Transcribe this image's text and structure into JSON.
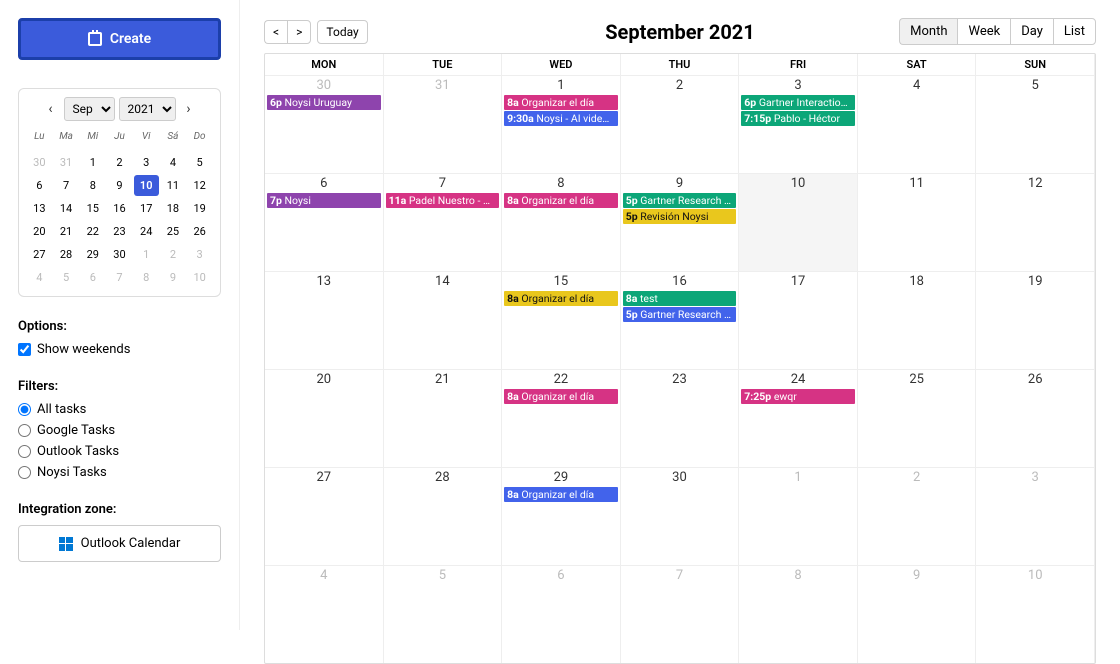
{
  "sidebar": {
    "create_label": "Create",
    "month_select": "Sep",
    "year_select": "2021",
    "mini_heads": [
      "Lu",
      "Ma",
      "Mi",
      "Ju",
      "Vi",
      "Sá",
      "Do"
    ],
    "mini_days": [
      {
        "n": "30",
        "m": true
      },
      {
        "n": "31",
        "m": true
      },
      {
        "n": "1"
      },
      {
        "n": "2"
      },
      {
        "n": "3"
      },
      {
        "n": "4"
      },
      {
        "n": "5"
      },
      {
        "n": "6"
      },
      {
        "n": "7"
      },
      {
        "n": "8"
      },
      {
        "n": "9"
      },
      {
        "n": "10",
        "today": true
      },
      {
        "n": "11"
      },
      {
        "n": "12"
      },
      {
        "n": "13"
      },
      {
        "n": "14"
      },
      {
        "n": "15"
      },
      {
        "n": "16"
      },
      {
        "n": "17"
      },
      {
        "n": "18"
      },
      {
        "n": "19"
      },
      {
        "n": "20"
      },
      {
        "n": "21"
      },
      {
        "n": "22"
      },
      {
        "n": "23"
      },
      {
        "n": "24"
      },
      {
        "n": "25"
      },
      {
        "n": "26"
      },
      {
        "n": "27"
      },
      {
        "n": "28"
      },
      {
        "n": "29"
      },
      {
        "n": "30"
      },
      {
        "n": "1",
        "m": true
      },
      {
        "n": "2",
        "m": true
      },
      {
        "n": "3",
        "m": true
      },
      {
        "n": "4",
        "m": true
      },
      {
        "n": "5",
        "m": true
      },
      {
        "n": "6",
        "m": true
      },
      {
        "n": "7",
        "m": true
      },
      {
        "n": "8",
        "m": true
      },
      {
        "n": "9",
        "m": true
      },
      {
        "n": "10",
        "m": true
      }
    ],
    "options_title": "Options:",
    "show_weekends_label": "Show weekends",
    "filters_title": "Filters:",
    "filters": [
      {
        "label": "All tasks",
        "checked": true
      },
      {
        "label": "Google Tasks",
        "checked": false
      },
      {
        "label": "Outlook Tasks",
        "checked": false
      },
      {
        "label": "Noysi Tasks",
        "checked": false
      }
    ],
    "integration_title": "Integration zone:",
    "outlook_label": "Outlook Calendar"
  },
  "toolbar": {
    "prev": "<",
    "next": ">",
    "today": "Today",
    "title": "September 2021",
    "views": [
      "Month",
      "Week",
      "Day",
      "List"
    ],
    "active_view": "Month"
  },
  "calendar": {
    "heads": [
      "MON",
      "TUE",
      "WED",
      "THU",
      "FRI",
      "SAT",
      "SUN"
    ],
    "cells": [
      {
        "n": "30",
        "muted": true,
        "events": [
          {
            "t": "6p",
            "txt": "Noysi Uruguay",
            "c": "purple"
          }
        ]
      },
      {
        "n": "31",
        "muted": true,
        "events": []
      },
      {
        "n": "1",
        "events": [
          {
            "t": "8a",
            "txt": "Organizar el día",
            "c": "pink"
          },
          {
            "t": "9:30a",
            "txt": "Noysi - AI video analy",
            "c": "blue"
          }
        ]
      },
      {
        "n": "2",
        "events": []
      },
      {
        "n": "3",
        "events": [
          {
            "t": "6p",
            "txt": "Gartner Interaction – (Re",
            "c": "teal"
          },
          {
            "t": "7:15p",
            "txt": "Pablo - Héctor",
            "c": "teal"
          }
        ]
      },
      {
        "n": "4",
        "events": []
      },
      {
        "n": "5",
        "events": []
      },
      {
        "n": "6",
        "events": [
          {
            "t": "7p",
            "txt": "Noysi",
            "c": "purple"
          }
        ]
      },
      {
        "n": "7",
        "events": [
          {
            "t": "11a",
            "txt": "Padel Nuestro - Noysi",
            "c": "pink"
          }
        ]
      },
      {
        "n": "8",
        "events": [
          {
            "t": "8a",
            "txt": "Organizar el día",
            "c": "pink"
          }
        ]
      },
      {
        "n": "9",
        "events": [
          {
            "t": "5p",
            "txt": "Gartner Research Conne",
            "c": "teal"
          },
          {
            "t": "5p",
            "txt": "Revisión Noysi",
            "c": "yellow"
          }
        ]
      },
      {
        "n": "10",
        "today": true,
        "events": []
      },
      {
        "n": "11",
        "events": []
      },
      {
        "n": "12",
        "events": []
      },
      {
        "n": "13",
        "events": []
      },
      {
        "n": "14",
        "events": []
      },
      {
        "n": "15",
        "events": [
          {
            "t": "8a",
            "txt": "Organizar el día",
            "c": "yellow"
          }
        ]
      },
      {
        "n": "16",
        "events": [
          {
            "t": "8a",
            "txt": "test",
            "c": "teal"
          },
          {
            "t": "5p",
            "txt": "Gartner Research Conne",
            "c": "blue"
          }
        ]
      },
      {
        "n": "17",
        "events": []
      },
      {
        "n": "18",
        "events": []
      },
      {
        "n": "19",
        "events": []
      },
      {
        "n": "20",
        "events": []
      },
      {
        "n": "21",
        "events": []
      },
      {
        "n": "22",
        "events": [
          {
            "t": "8a",
            "txt": "Organizar el día",
            "c": "pink"
          }
        ]
      },
      {
        "n": "23",
        "events": []
      },
      {
        "n": "24",
        "events": [
          {
            "t": "7:25p",
            "txt": "ewqr",
            "c": "pink"
          }
        ]
      },
      {
        "n": "25",
        "events": []
      },
      {
        "n": "26",
        "events": []
      },
      {
        "n": "27",
        "events": []
      },
      {
        "n": "28",
        "events": []
      },
      {
        "n": "29",
        "events": [
          {
            "t": "8a",
            "txt": "Organizar el día",
            "c": "blue"
          }
        ]
      },
      {
        "n": "30",
        "events": []
      },
      {
        "n": "1",
        "muted": true,
        "events": []
      },
      {
        "n": "2",
        "muted": true,
        "events": []
      },
      {
        "n": "3",
        "muted": true,
        "events": []
      },
      {
        "n": "4",
        "muted": true,
        "events": []
      },
      {
        "n": "5",
        "muted": true,
        "events": []
      },
      {
        "n": "6",
        "muted": true,
        "events": []
      },
      {
        "n": "7",
        "muted": true,
        "events": []
      },
      {
        "n": "8",
        "muted": true,
        "events": []
      },
      {
        "n": "9",
        "muted": true,
        "events": []
      },
      {
        "n": "10",
        "muted": true,
        "events": []
      }
    ]
  }
}
